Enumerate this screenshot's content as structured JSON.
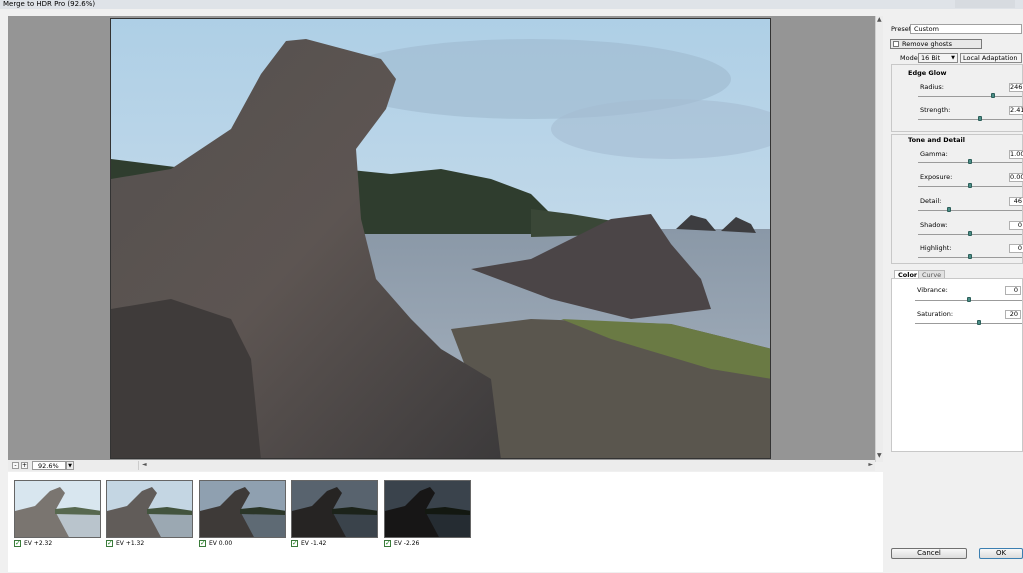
{
  "window": {
    "title": "Merge to HDR Pro (92.6%)"
  },
  "zoom": {
    "value": "92.6%",
    "minus_label": "-",
    "plus_label": "+"
  },
  "panel": {
    "preset_label": "Preset:",
    "preset_value": "Custom",
    "remove_ghosts_label": "Remove ghosts",
    "mode_label": "Mode:",
    "mode_bit_value": "16 Bit",
    "mode_method_value": "Local Adaptation",
    "edge_glow": {
      "header": "Edge Glow",
      "radius_label": "Radius:",
      "radius_value": "246",
      "strength_label": "Strength:",
      "strength_value": "2.41"
    },
    "tone_detail": {
      "header": "Tone and Detail",
      "gamma_label": "Gamma:",
      "gamma_value": "1.00",
      "exposure_label": "Exposure:",
      "exposure_value": "0.00",
      "detail_label": "Detail:",
      "detail_value": "46",
      "shadow_label": "Shadow:",
      "shadow_value": "0",
      "highlight_label": "Highlight:",
      "highlight_value": "0"
    },
    "tabs": {
      "color_label": "Color",
      "curve_label": "Curve"
    },
    "color": {
      "vibrance_label": "Vibrance:",
      "vibrance_value": "0",
      "saturation_label": "Saturation:",
      "saturation_value": "20"
    },
    "cancel_label": "Cancel",
    "ok_label": "OK"
  },
  "filmstrip": [
    {
      "label": "EV +2.32",
      "checked": true
    },
    {
      "label": "EV +1.32",
      "checked": true
    },
    {
      "label": "EV 0.00",
      "checked": true
    },
    {
      "label": "EV -1.42",
      "checked": true
    },
    {
      "label": "EV -2.26",
      "checked": true
    }
  ],
  "slider_levels": {
    "radius": 0.72,
    "strength": 0.6,
    "gamma": 0.5,
    "exposure": 0.5,
    "detail": 0.3,
    "shadow": 0.5,
    "highlight": 0.5,
    "vibrance": 0.5,
    "saturation": 0.6
  },
  "colors": {
    "accent": "#4a8d86"
  }
}
